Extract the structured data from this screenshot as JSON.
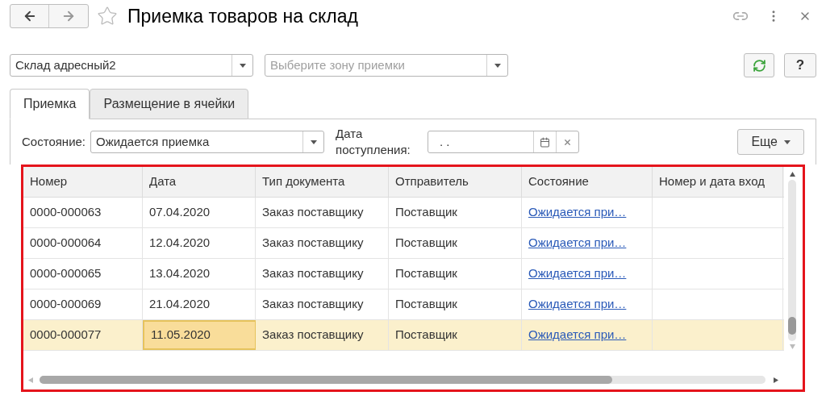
{
  "window": {
    "title": "Приемка товаров на склад",
    "favorite": false
  },
  "warehouse_select": {
    "value": "Склад адресный2"
  },
  "zone_select": {
    "placeholder": "Выберите зону приемки"
  },
  "help_button": "?",
  "tabs": [
    {
      "label": "Приемка",
      "selected": true
    },
    {
      "label": "Размещение в ячейки",
      "selected": false
    }
  ],
  "filters": {
    "state_label": "Состояние:",
    "state_value": "Ожидается приемка",
    "date_label": "Дата поступления:",
    "date_value": ". .",
    "more_button": "Еще"
  },
  "table": {
    "highlighted": true,
    "columns": [
      "Номер",
      "Дата",
      "Тип документа",
      "Отправитель",
      "Состояние",
      "Номер и дата вход"
    ],
    "rows": [
      {
        "selected": false,
        "cells": [
          {
            "kind": "text",
            "text": "0000-000063",
            "focused": false
          },
          {
            "kind": "text",
            "text": "07.04.2020",
            "focused": false
          },
          {
            "kind": "text",
            "text": "Заказ поставщику",
            "focused": false
          },
          {
            "kind": "text",
            "text": "Поставщик",
            "focused": false
          },
          {
            "kind": "link",
            "text": "Ожидается при…",
            "focused": false
          }
        ]
      },
      {
        "selected": false,
        "cells": [
          {
            "kind": "text",
            "text": "0000-000064",
            "focused": false
          },
          {
            "kind": "text",
            "text": "12.04.2020",
            "focused": false
          },
          {
            "kind": "text",
            "text": "Заказ поставщику",
            "focused": false
          },
          {
            "kind": "text",
            "text": "Поставщик",
            "focused": false
          },
          {
            "kind": "link",
            "text": "Ожидается при…",
            "focused": false
          }
        ]
      },
      {
        "selected": false,
        "cells": [
          {
            "kind": "text",
            "text": "0000-000065",
            "focused": false
          },
          {
            "kind": "text",
            "text": "13.04.2020",
            "focused": false
          },
          {
            "kind": "text",
            "text": "Заказ поставщику",
            "focused": false
          },
          {
            "kind": "text",
            "text": "Поставщик",
            "focused": false
          },
          {
            "kind": "link",
            "text": "Ожидается при…",
            "focused": false
          }
        ]
      },
      {
        "selected": false,
        "cells": [
          {
            "kind": "text",
            "text": "0000-000069",
            "focused": false
          },
          {
            "kind": "text",
            "text": "21.04.2020",
            "focused": false
          },
          {
            "kind": "text",
            "text": "Заказ поставщику",
            "focused": false
          },
          {
            "kind": "text",
            "text": "Поставщик",
            "focused": false
          },
          {
            "kind": "link",
            "text": "Ожидается при…",
            "focused": false
          }
        ]
      },
      {
        "selected": true,
        "cells": [
          {
            "kind": "text",
            "text": "0000-000077",
            "focused": false
          },
          {
            "kind": "text",
            "text": "11.05.2020",
            "focused": true
          },
          {
            "kind": "text",
            "text": "Заказ поставщику",
            "focused": false
          },
          {
            "kind": "text",
            "text": "Поставщик",
            "focused": false
          },
          {
            "kind": "link",
            "text": "Ожидается при…",
            "focused": false
          }
        ]
      }
    ]
  }
}
